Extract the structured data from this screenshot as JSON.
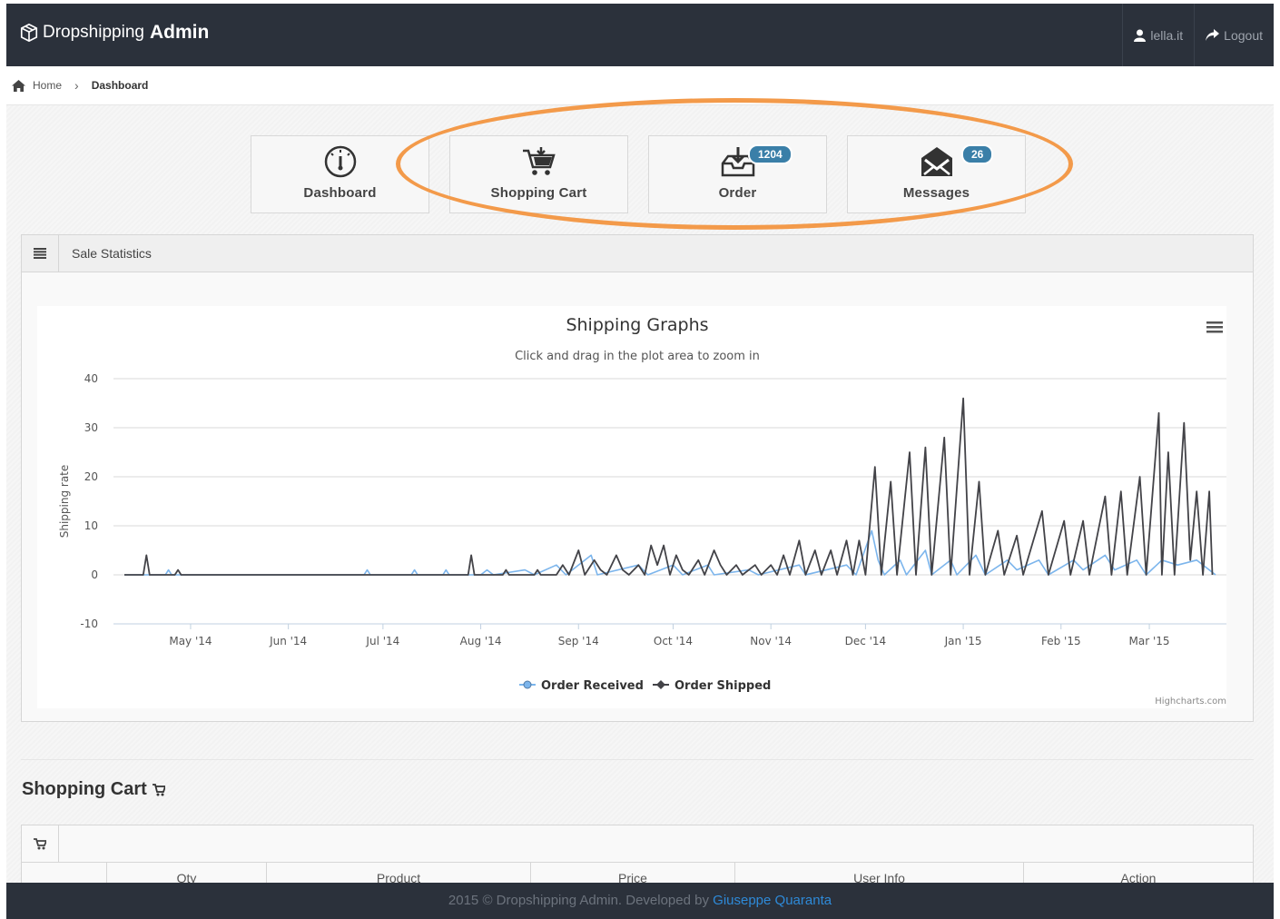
{
  "header": {
    "brand_prefix": "Dropshipping",
    "brand_bold": "Admin",
    "user_label": "lella.it",
    "logout_label": "Logout"
  },
  "breadcrumb": {
    "home": "Home",
    "current": "Dashboard"
  },
  "tiles": [
    {
      "label": "Dashboard",
      "icon": "dashboard-gauge-icon",
      "badge": ""
    },
    {
      "label": "Shopping Cart",
      "icon": "shopping-cart-icon",
      "badge": ""
    },
    {
      "label": "Order",
      "icon": "inbox-download-icon",
      "badge": "1204"
    },
    {
      "label": "Messages",
      "icon": "envelope-open-icon",
      "badge": "26"
    }
  ],
  "panel": {
    "title": "Sale Statistics"
  },
  "chart_data": {
    "type": "line",
    "title": "Shipping Graphs",
    "subtitle": "Click and drag in the plot area to zoom in",
    "ylabel": "Shipping rate",
    "xlabel": "",
    "ylim": [
      -10,
      40
    ],
    "yticks": [
      -10,
      0,
      10,
      20,
      30,
      40
    ],
    "xticks": [
      "May '14",
      "Jun '14",
      "Jul '14",
      "Aug '14",
      "Sep '14",
      "Oct '14",
      "Nov '14",
      "Dec '14",
      "Jan '15",
      "Feb '15",
      "Mar '15"
    ],
    "x_range": [
      "2014-04-10",
      "2015-03-22"
    ],
    "grid": true,
    "legend_position": "bottom-center",
    "credits": "Highcharts.com",
    "series": [
      {
        "name": "Order Received",
        "color": "#7cb5ec",
        "points": [
          [
            "2014-04-10",
            0
          ],
          [
            "2014-04-23",
            0
          ],
          [
            "2014-04-24",
            1
          ],
          [
            "2014-04-25",
            0
          ],
          [
            "2014-06-25",
            0
          ],
          [
            "2014-06-26",
            1
          ],
          [
            "2014-06-27",
            0
          ],
          [
            "2014-07-10",
            0
          ],
          [
            "2014-07-11",
            1
          ],
          [
            "2014-07-12",
            0
          ],
          [
            "2014-07-20",
            0
          ],
          [
            "2014-07-21",
            1
          ],
          [
            "2014-07-22",
            0
          ],
          [
            "2014-08-01",
            0
          ],
          [
            "2014-08-03",
            1
          ],
          [
            "2014-08-05",
            0
          ],
          [
            "2014-08-15",
            1
          ],
          [
            "2014-08-18",
            0
          ],
          [
            "2014-08-25",
            2
          ],
          [
            "2014-08-28",
            0
          ],
          [
            "2014-09-05",
            4
          ],
          [
            "2014-09-07",
            0
          ],
          [
            "2014-09-20",
            2
          ],
          [
            "2014-09-23",
            0
          ],
          [
            "2014-10-01",
            2
          ],
          [
            "2014-10-04",
            0
          ],
          [
            "2014-10-12",
            2
          ],
          [
            "2014-10-14",
            0
          ],
          [
            "2014-10-25",
            1
          ],
          [
            "2014-10-28",
            0
          ],
          [
            "2014-11-10",
            2
          ],
          [
            "2014-11-12",
            0
          ],
          [
            "2014-11-25",
            2
          ],
          [
            "2014-11-28",
            0
          ],
          [
            "2014-12-03",
            9
          ],
          [
            "2014-12-05",
            3
          ],
          [
            "2014-12-07",
            0
          ],
          [
            "2014-12-12",
            3
          ],
          [
            "2014-12-14",
            0
          ],
          [
            "2014-12-20",
            5
          ],
          [
            "2014-12-22",
            0
          ],
          [
            "2014-12-28",
            3
          ],
          [
            "2014-12-30",
            0
          ],
          [
            "2015-01-05",
            4
          ],
          [
            "2015-01-08",
            0
          ],
          [
            "2015-01-15",
            3
          ],
          [
            "2015-01-18",
            1
          ],
          [
            "2015-01-25",
            3
          ],
          [
            "2015-01-28",
            0
          ],
          [
            "2015-02-05",
            3
          ],
          [
            "2015-02-08",
            1
          ],
          [
            "2015-02-15",
            4
          ],
          [
            "2015-02-18",
            1
          ],
          [
            "2015-02-25",
            3
          ],
          [
            "2015-02-28",
            0
          ],
          [
            "2015-03-05",
            3
          ],
          [
            "2015-03-10",
            2
          ],
          [
            "2015-03-16",
            3
          ],
          [
            "2015-03-22",
            0
          ]
        ]
      },
      {
        "name": "Order Shipped",
        "color": "#434348",
        "points": [
          [
            "2014-04-10",
            0
          ],
          [
            "2014-04-16",
            0
          ],
          [
            "2014-04-17",
            4
          ],
          [
            "2014-04-18",
            0
          ],
          [
            "2014-04-26",
            0
          ],
          [
            "2014-04-27",
            1
          ],
          [
            "2014-04-28",
            0
          ],
          [
            "2014-07-28",
            0
          ],
          [
            "2014-07-29",
            4
          ],
          [
            "2014-07-30",
            0
          ],
          [
            "2014-08-08",
            0
          ],
          [
            "2014-08-09",
            1
          ],
          [
            "2014-08-10",
            0
          ],
          [
            "2014-08-18",
            0
          ],
          [
            "2014-08-19",
            1
          ],
          [
            "2014-08-20",
            0
          ],
          [
            "2014-08-25",
            0
          ],
          [
            "2014-08-27",
            2
          ],
          [
            "2014-08-29",
            0
          ],
          [
            "2014-09-01",
            5
          ],
          [
            "2014-09-03",
            0
          ],
          [
            "2014-09-06",
            3
          ],
          [
            "2014-09-08",
            1
          ],
          [
            "2014-09-10",
            0
          ],
          [
            "2014-09-13",
            4
          ],
          [
            "2014-09-15",
            1
          ],
          [
            "2014-09-17",
            0
          ],
          [
            "2014-09-20",
            2
          ],
          [
            "2014-09-22",
            0
          ],
          [
            "2014-09-24",
            6
          ],
          [
            "2014-09-26",
            2
          ],
          [
            "2014-09-28",
            6
          ],
          [
            "2014-09-30",
            0
          ],
          [
            "2014-10-02",
            4
          ],
          [
            "2014-10-04",
            1
          ],
          [
            "2014-10-06",
            0
          ],
          [
            "2014-10-09",
            3
          ],
          [
            "2014-10-11",
            0
          ],
          [
            "2014-10-14",
            5
          ],
          [
            "2014-10-16",
            2
          ],
          [
            "2014-10-18",
            0
          ],
          [
            "2014-10-21",
            2
          ],
          [
            "2014-10-23",
            0
          ],
          [
            "2014-10-27",
            2
          ],
          [
            "2014-10-29",
            0
          ],
          [
            "2014-11-01",
            2
          ],
          [
            "2014-11-03",
            0
          ],
          [
            "2014-11-05",
            4
          ],
          [
            "2014-11-07",
            0
          ],
          [
            "2014-11-10",
            7
          ],
          [
            "2014-11-12",
            0
          ],
          [
            "2014-11-15",
            5
          ],
          [
            "2014-11-17",
            0
          ],
          [
            "2014-11-20",
            5
          ],
          [
            "2014-11-22",
            0
          ],
          [
            "2014-11-25",
            7
          ],
          [
            "2014-11-27",
            0
          ],
          [
            "2014-11-29",
            7
          ],
          [
            "2014-12-01",
            0
          ],
          [
            "2014-12-04",
            22
          ],
          [
            "2014-12-06",
            0
          ],
          [
            "2014-12-09",
            19
          ],
          [
            "2014-12-11",
            0
          ],
          [
            "2014-12-15",
            25
          ],
          [
            "2014-12-17",
            0
          ],
          [
            "2014-12-20",
            26
          ],
          [
            "2014-12-22",
            0
          ],
          [
            "2014-12-26",
            28
          ],
          [
            "2014-12-28",
            0
          ],
          [
            "2015-01-01",
            36
          ],
          [
            "2015-01-03",
            0
          ],
          [
            "2015-01-06",
            19
          ],
          [
            "2015-01-08",
            0
          ],
          [
            "2015-01-12",
            9
          ],
          [
            "2015-01-14",
            0
          ],
          [
            "2015-01-18",
            8
          ],
          [
            "2015-01-20",
            0
          ],
          [
            "2015-01-26",
            13
          ],
          [
            "2015-01-28",
            0
          ],
          [
            "2015-02-02",
            11
          ],
          [
            "2015-02-04",
            0
          ],
          [
            "2015-02-08",
            11
          ],
          [
            "2015-02-10",
            0
          ],
          [
            "2015-02-15",
            16
          ],
          [
            "2015-02-17",
            0
          ],
          [
            "2015-02-20",
            17
          ],
          [
            "2015-02-22",
            0
          ],
          [
            "2015-02-26",
            20
          ],
          [
            "2015-02-28",
            0
          ],
          [
            "2015-03-04",
            33
          ],
          [
            "2015-03-05",
            0
          ],
          [
            "2015-03-07",
            25
          ],
          [
            "2015-03-09",
            0
          ],
          [
            "2015-03-12",
            31
          ],
          [
            "2015-03-14",
            3
          ],
          [
            "2015-03-16",
            17
          ],
          [
            "2015-03-18",
            0
          ],
          [
            "2015-03-20",
            17
          ],
          [
            "2015-03-21",
            0
          ]
        ]
      }
    ]
  },
  "shopping_cart": {
    "title": "Shopping Cart",
    "columns": [
      "",
      "Qty",
      "Product",
      "Price",
      "User Info",
      "Action"
    ]
  },
  "footer": {
    "text": "2015 © Dropshipping Admin. Developed by",
    "author": "Giuseppe Quaranta"
  }
}
